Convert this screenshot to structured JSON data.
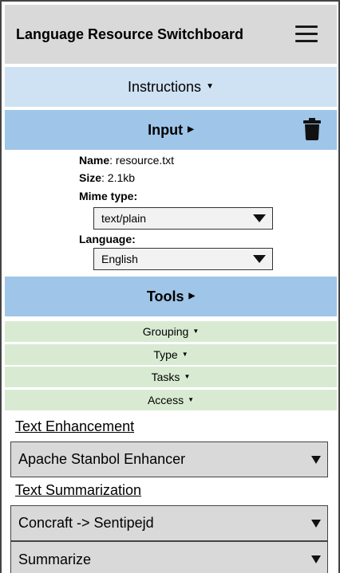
{
  "header": {
    "title": "Language Resource Switchboard"
  },
  "instructions": {
    "label": "Instructions",
    "caret": "▼"
  },
  "input": {
    "label": "Input",
    "caret": "▶",
    "name_label": "Name",
    "name_value": ": resource.txt",
    "size_label": "Size",
    "size_value": ": 2.1kb",
    "mime_label": "Mime type:",
    "mime_value": "text/plain",
    "language_label": "Language:",
    "language_value": "English"
  },
  "tools": {
    "label": "Tools",
    "caret": "▶",
    "filters": [
      {
        "label": "Grouping",
        "caret": "▼"
      },
      {
        "label": "Type",
        "caret": "▼"
      },
      {
        "label": "Tasks",
        "caret": "▼"
      },
      {
        "label": "Access",
        "caret": "▼"
      }
    ]
  },
  "sections": [
    {
      "title": "Text Enhancement",
      "selects": [
        "Apache Stanbol Enhancer"
      ]
    },
    {
      "title": "Text Summarization",
      "selects": [
        "Concraft -> Sentipejd",
        "Summarize"
      ]
    }
  ],
  "icons": {
    "menu": "hamburger-menu-icon",
    "trash": "trash-icon",
    "dropdown": "triangle-down-icon"
  }
}
